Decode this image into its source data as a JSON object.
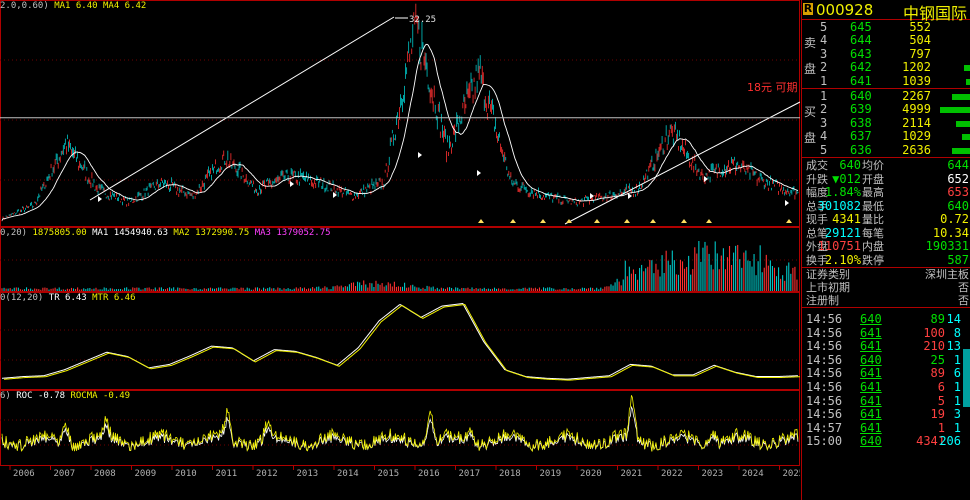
{
  "main": {
    "header": {
      "ma1": "MA1 6.40",
      "ma4": "MA4 6.42",
      "prefix": "2.0,0.60)"
    },
    "annotations": {
      "peak": "32.25",
      "note": "18元 可期"
    }
  },
  "volume": {
    "header": {
      "prefix": "0,20)",
      "vol": "1875805.00",
      "ma1": "MA1 1454940.63",
      "ma2": "MA2 1372990.75",
      "ma3": "MA3 1379052.75"
    }
  },
  "mtr": {
    "header": {
      "prefix": "0(12,20)",
      "tr": "TR 6.43",
      "mtr": "MTR 6.46"
    }
  },
  "roc": {
    "header": {
      "prefix": "6)",
      "roc": "ROC -0.78",
      "rocma": "ROCMA -0.49"
    }
  },
  "years": [
    "2006",
    "2007",
    "2008",
    "2009",
    "2010",
    "2011",
    "2012",
    "2013",
    "2014",
    "2015",
    "2016",
    "2017",
    "2018",
    "2019",
    "2020",
    "2021",
    "2022",
    "2023",
    "2024",
    "2025"
  ],
  "chart_data": [
    {
      "type": "line",
      "title": "",
      "annotations": [
        "32.25",
        "18元 可期"
      ],
      "series": [
        {
          "name": "MA1",
          "values": [
            6.4
          ]
        },
        {
          "name": "MA4",
          "values": [
            6.42
          ]
        }
      ],
      "x": [
        "2006",
        "2007",
        "2008",
        "2009",
        "2010",
        "2011",
        "2012",
        "2013",
        "2014",
        "2015",
        "2016",
        "2017",
        "2018",
        "2019",
        "2020",
        "2021",
        "2022",
        "2023",
        "2024",
        "2025"
      ],
      "price_path": [
        2.5,
        4.5,
        14,
        7,
        5,
        8,
        6,
        12,
        7,
        9,
        8,
        6,
        8,
        32.25,
        13,
        25,
        8,
        6,
        5,
        6,
        7,
        16,
        9,
        11,
        8,
        6.4
      ],
      "peak": 32.25,
      "reference_line": 18
    },
    {
      "type": "bar",
      "series": [
        {
          "name": "VOL",
          "values": [
            1875805.0
          ]
        },
        {
          "name": "MA1",
          "values": [
            1454940.63
          ]
        },
        {
          "name": "MA2",
          "values": [
            1372990.75
          ]
        },
        {
          "name": "MA3",
          "values": [
            1379052.75
          ]
        }
      ]
    },
    {
      "type": "line",
      "series": [
        {
          "name": "TR",
          "values": [
            6.43
          ]
        },
        {
          "name": "MTR",
          "values": [
            6.46
          ]
        }
      ],
      "curve": [
        1,
        1.2,
        1.3,
        2,
        3,
        4,
        3.5,
        2.2,
        2.6,
        3.6,
        4.7,
        4.5,
        3,
        4.3,
        4.1,
        3.4,
        2.5,
        4.5,
        7.6,
        9.5,
        8,
        9.3,
        9.6,
        5.2,
        2,
        1.2,
        1,
        0.9,
        1.1,
        1.3,
        2.6,
        2.4,
        1.4,
        1.4,
        2.5,
        1.7,
        1.2,
        1.2,
        1.3
      ]
    },
    {
      "type": "line",
      "series": [
        {
          "name": "ROC",
          "values": [
            -0.78
          ]
        },
        {
          "name": "ROCMA",
          "values": [
            -0.49
          ]
        }
      ],
      "spikes": [
        [
          "2007",
          7
        ],
        [
          "2008",
          4
        ],
        [
          "2011",
          8
        ],
        [
          "2012",
          5
        ],
        [
          "2016",
          9
        ],
        [
          "2017",
          4
        ],
        [
          "2021",
          12
        ],
        [
          "2023",
          4
        ]
      ]
    }
  ],
  "quote": {
    "code": "000928",
    "name": "中钢国际",
    "sell_label": [
      "卖",
      "盘"
    ],
    "buy_label": [
      "买",
      "盘"
    ],
    "sell": [
      {
        "lv": "5",
        "price": "645",
        "vol": "552",
        "bar": 0
      },
      {
        "lv": "4",
        "price": "644",
        "vol": "504",
        "bar": 0
      },
      {
        "lv": "3",
        "price": "643",
        "vol": "797",
        "bar": 0
      },
      {
        "lv": "2",
        "price": "642",
        "vol": "1202",
        "bar": 6
      },
      {
        "lv": "1",
        "price": "641",
        "vol": "1039",
        "bar": 4
      }
    ],
    "buy": [
      {
        "lv": "1",
        "price": "640",
        "vol": "2267",
        "bar": 18
      },
      {
        "lv": "2",
        "price": "639",
        "vol": "4999",
        "bar": 30
      },
      {
        "lv": "3",
        "price": "638",
        "vol": "2114",
        "bar": 14
      },
      {
        "lv": "4",
        "price": "637",
        "vol": "1029",
        "bar": 8
      },
      {
        "lv": "5",
        "price": "636",
        "vol": "2636",
        "bar": 18
      }
    ],
    "stats": [
      {
        "l1": "成交",
        "v1": "640",
        "c1": "green",
        "l2": "均价",
        "v2": "644",
        "c2": "green"
      },
      {
        "l1": "升跌",
        "v1": "▼012",
        "c1": "green",
        "l2": "开盘",
        "v2": "652",
        "c2": "white"
      },
      {
        "l1": "幅度",
        "v1": "1.84%",
        "c1": "green",
        "l2": "最高",
        "v2": "653",
        "c2": "red"
      },
      {
        "l1": "总手",
        "v1": "301082",
        "c1": "cyan",
        "l2": "最低",
        "v2": "640",
        "c2": "green"
      },
      {
        "l1": "现手",
        "v1": "4341",
        "c1": "yellow",
        "l2": "量比",
        "v2": "0.72",
        "c2": "yellow"
      },
      {
        "l1": "总笔",
        "v1": "29121",
        "c1": "cyan",
        "l2": "每笔",
        "v2": "10.34",
        "c2": "yellow"
      },
      {
        "l1": "外盘",
        "v1": "110751",
        "c1": "red",
        "l2": "内盘",
        "v2": "190331",
        "c2": "green"
      },
      {
        "l1": "换手",
        "v1": "2.10%",
        "c1": "yellow",
        "l2": "跌停",
        "v2": "587",
        "c2": "green"
      }
    ],
    "info": [
      {
        "label": "证券类别",
        "value": "深圳主板"
      },
      {
        "label": "上市初期",
        "value": "否"
      },
      {
        "label": "注册制",
        "value": "否"
      }
    ],
    "ticks": [
      {
        "time": "14:56",
        "price": "640",
        "vol": "89",
        "n": "14",
        "pc": "green",
        "vc": "green"
      },
      {
        "time": "14:56",
        "price": "641",
        "vol": "100",
        "n": "8",
        "pc": "green",
        "vc": "red"
      },
      {
        "time": "14:56",
        "price": "641",
        "vol": "210",
        "n": "13",
        "pc": "green",
        "vc": "red"
      },
      {
        "time": "14:56",
        "price": "640",
        "vol": "25",
        "n": "1",
        "pc": "green",
        "vc": "green"
      },
      {
        "time": "14:56",
        "price": "641",
        "vol": "89",
        "n": "6",
        "pc": "green",
        "vc": "red"
      },
      {
        "time": "14:56",
        "price": "641",
        "vol": "6",
        "n": "1",
        "pc": "green",
        "vc": "red"
      },
      {
        "time": "14:56",
        "price": "641",
        "vol": "5",
        "n": "1",
        "pc": "green",
        "vc": "red"
      },
      {
        "time": "14:56",
        "price": "641",
        "vol": "19",
        "n": "3",
        "pc": "green",
        "vc": "red"
      },
      {
        "time": "14:57",
        "price": "641",
        "vol": "1",
        "n": "1",
        "pc": "green",
        "vc": "red"
      },
      {
        "time": "15:00",
        "price": "640",
        "vol": "4341",
        "n": "206",
        "pc": "green",
        "vc": "red"
      }
    ]
  }
}
